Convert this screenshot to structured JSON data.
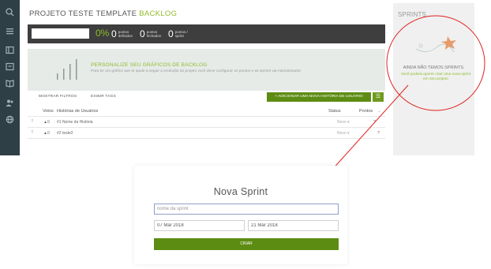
{
  "nav": {
    "icons": [
      "search-icon",
      "menu-icon",
      "backlog-icon",
      "kanban-icon",
      "wiki-icon",
      "team-icon",
      "admin-icon"
    ]
  },
  "backlog": {
    "title_prefix": "PROJETO TESTE TEMPLATE",
    "title_accent": "BACKLOG",
    "summary": {
      "percent": "0%",
      "defined_points": "0",
      "defined_label_1": "pontos",
      "defined_label_2": "definidos",
      "closed_points": "0",
      "closed_label_1": "pontos",
      "closed_label_2": "fechados",
      "sprint_points": "0",
      "sprint_label_1": "pontos /",
      "sprint_label_2": "sprint"
    },
    "charts_banner": {
      "title": "PERSONALIZE SEU GRÁFICOS DE BACKLOG",
      "text": "Para ter um gráfico que te ajude a seguir a evolução do projeto você deve configurar os pontos e as sprints via Administrador"
    },
    "toolbar": {
      "show_filters": "MOSTRAR FILTROS",
      "show_tags": "EXIBIR TAGS",
      "add_story": "+ ADICIONAR UMA NOVA HISTÓRIA DE USUÁRIO"
    },
    "table": {
      "col_votes": "Votos",
      "col_stories": "Histórias de Usuários",
      "col_status": "Status",
      "col_points": "Pontos",
      "rows": [
        {
          "votes": "▲0",
          "story": "#1 Nome da História",
          "status": "Novo ▾",
          "points": "?"
        },
        {
          "votes": "▲0",
          "story": "#2 teste2",
          "status": "Novo ▾",
          "points": "?"
        }
      ]
    }
  },
  "sprints": {
    "title": "SPRINTS",
    "empty_title": "AINDA NÃO TEMOS SPRINTS.",
    "empty_text": "Você poderá querer criar uma nova sprint em seu projeto"
  },
  "dialog": {
    "title": "Nova Sprint",
    "name_placeholder": "nome da sprint",
    "start_date": "07 Mar 2018",
    "end_date": "21 Mar 2018",
    "create_label": "CRIAR"
  },
  "colors": {
    "accent_green": "#8fbc2a",
    "button_green": "#5d8c13",
    "nav_dark": "#2f3f46",
    "annotation_red": "#e02020"
  }
}
